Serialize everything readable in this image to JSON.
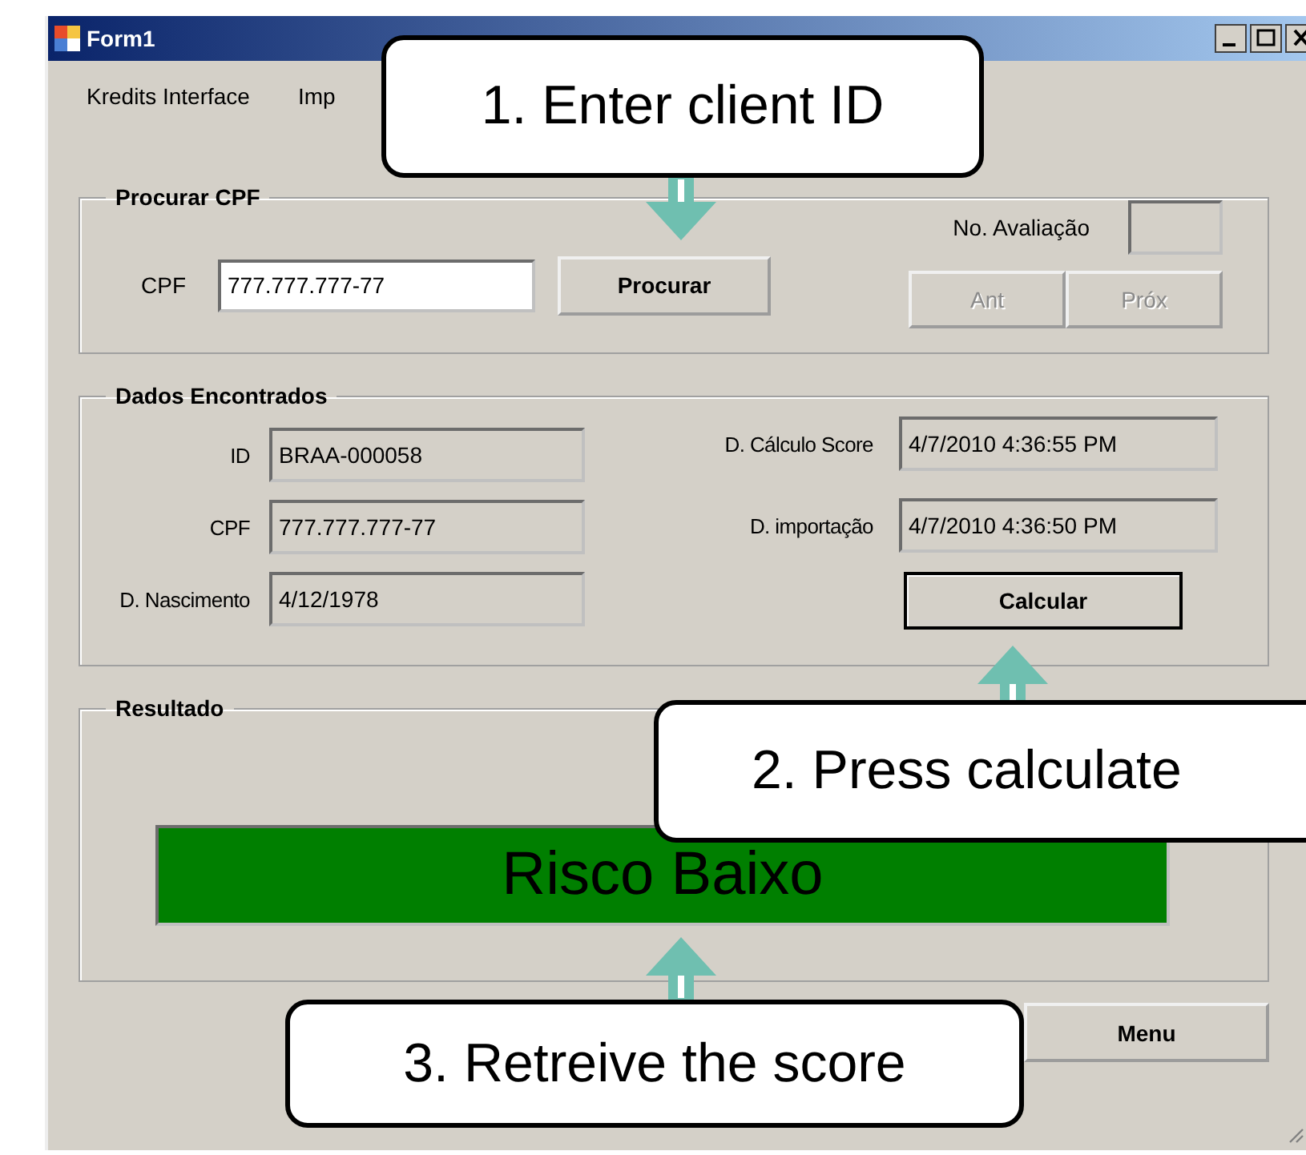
{
  "window": {
    "title": "Form1"
  },
  "menu": [
    {
      "label": "Kredits Interface"
    },
    {
      "label": "Imp"
    }
  ],
  "search_group": {
    "title": "Procurar CPF",
    "cpf_label": "CPF",
    "cpf_value": "777.777.777-77",
    "search_button": "Procurar",
    "evaluation_label": "No. Avaliação",
    "nav_buttons": [
      {
        "label": "Ant",
        "disabled": true
      },
      {
        "label": "Próx",
        "disabled": true
      }
    ]
  },
  "data_group": {
    "title": "Dados Encontrados",
    "left_fields": [
      {
        "label": "ID",
        "value": "BRAA-000058"
      },
      {
        "label": "CPF",
        "value": "777.777.777-77"
      },
      {
        "label": "D. Nascimento",
        "value": "4/12/1978"
      }
    ],
    "right_fields": [
      {
        "label": "D. Cálculo Score",
        "value": "4/7/2010 4:36:55 PM"
      },
      {
        "label": "D. importação",
        "value": "4/7/2010 4:36:50 PM"
      }
    ],
    "calculate_button": "Calcular"
  },
  "result_group": {
    "title": "Resultado",
    "result": "Risco Baixo"
  },
  "menu_button": "Menu",
  "callouts": [
    {
      "text": "1. Enter client ID",
      "kind": "below"
    },
    {
      "text": "2. Press calculate",
      "kind": "above"
    },
    {
      "text": "3. Retreive the score",
      "kind": "above"
    }
  ]
}
